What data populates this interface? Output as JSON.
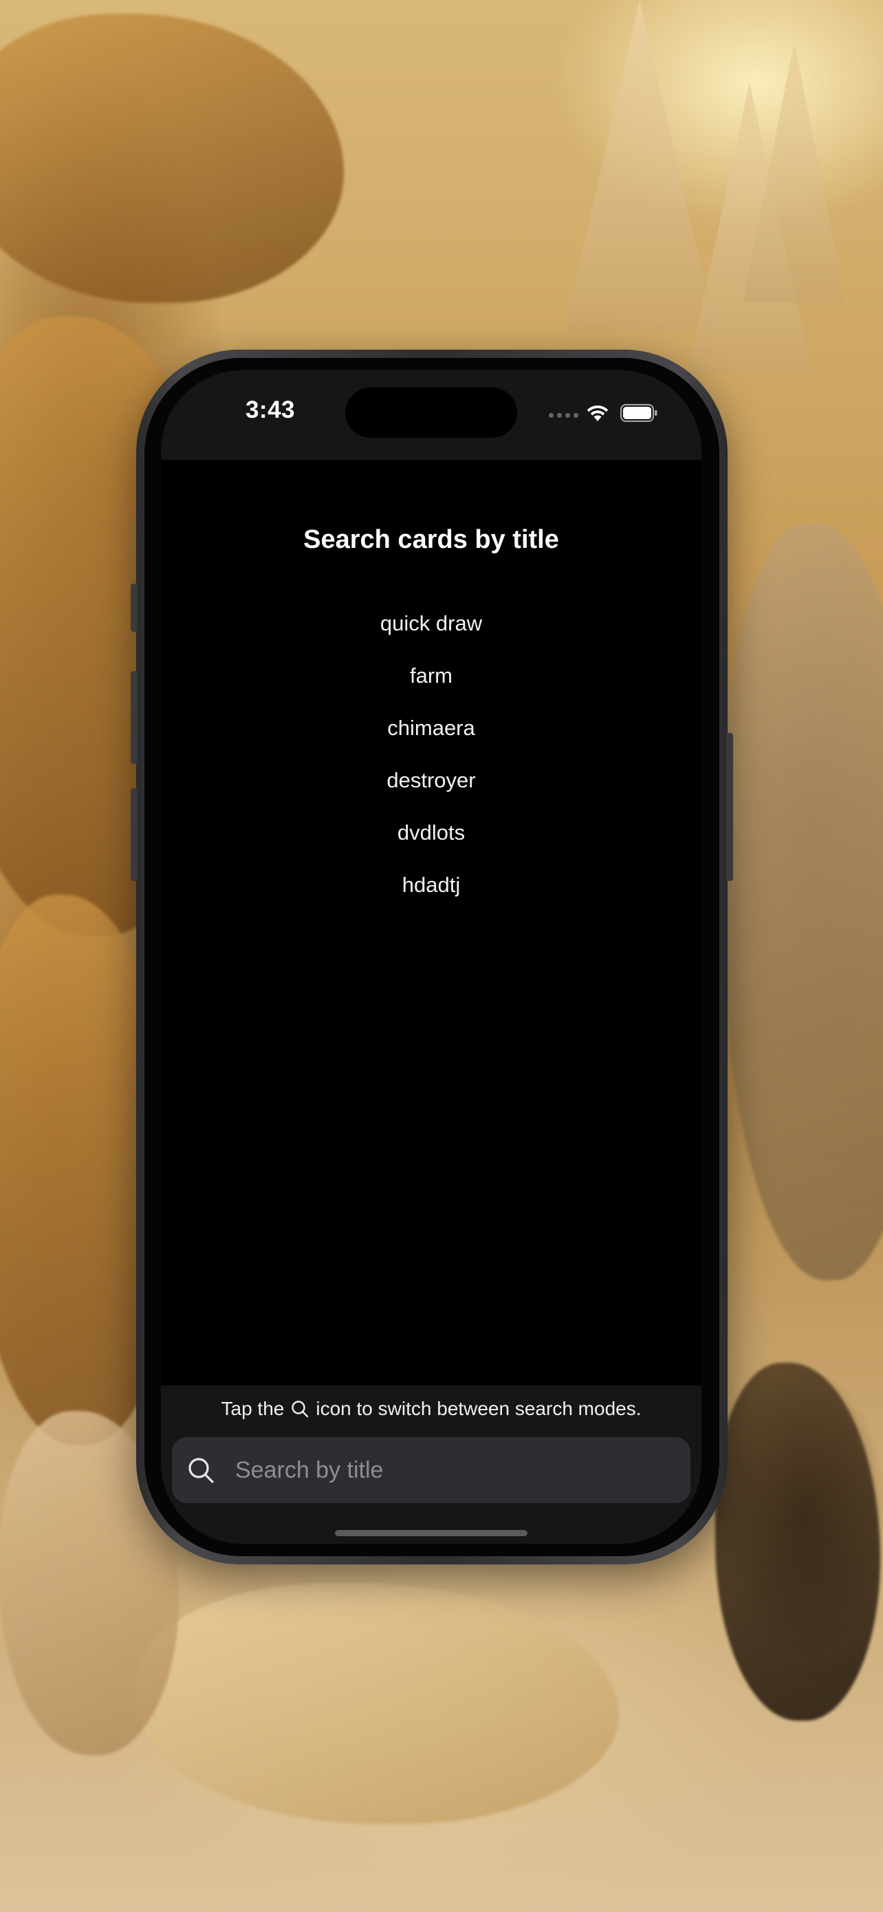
{
  "status_bar": {
    "time": "3:43"
  },
  "main": {
    "title": "Search cards by title",
    "cards": [
      "quick draw",
      "farm",
      "chimaera",
      "destroyer",
      "dvdlots",
      "hdadtj"
    ]
  },
  "footer": {
    "hint_before": "Tap the",
    "hint_after": "icon to switch between search modes.",
    "hint_icon": "search-icon",
    "search_placeholder": "Search by title",
    "search_value": ""
  },
  "colors": {
    "screen_background": "#000000",
    "panel_background": "#161616",
    "search_field_background": "#2c2e31",
    "placeholder": "#8c8e92",
    "text": "#ffffff"
  }
}
